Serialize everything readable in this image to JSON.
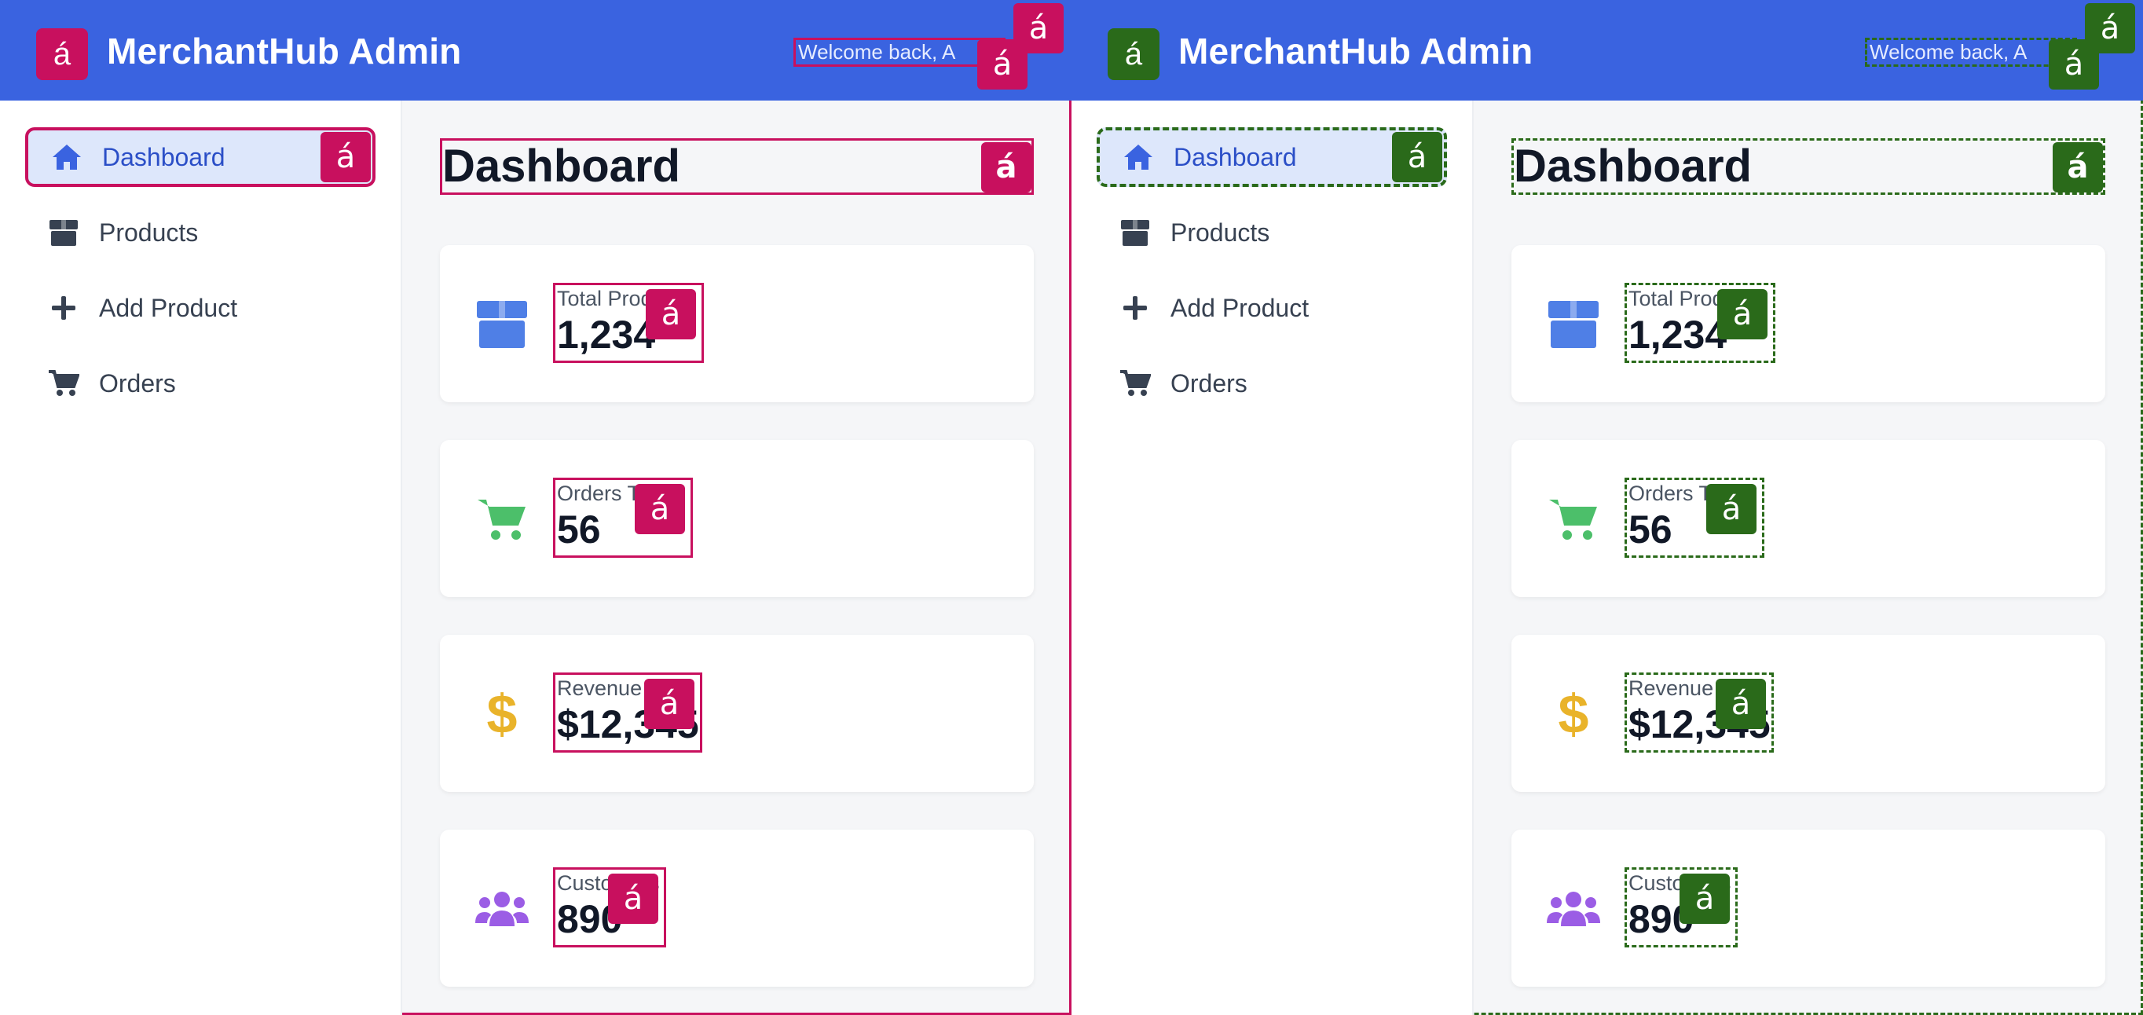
{
  "app": {
    "title": "MerchantHub Admin",
    "welcome_text": "Welcome back, A",
    "badge_glyph": "á",
    "logo_glyph": "á"
  },
  "sidebar": {
    "items": [
      {
        "label": "Dashboard",
        "icon": "home-icon",
        "active": true
      },
      {
        "label": "Products",
        "icon": "box-icon",
        "active": false
      },
      {
        "label": "Add Product",
        "icon": "plus-icon",
        "active": false
      },
      {
        "label": "Orders",
        "icon": "cart-icon",
        "active": false
      }
    ]
  },
  "main": {
    "page_title": "Dashboard",
    "stats": [
      {
        "label": "Total Products",
        "value": "1,234",
        "icon": "box-icon",
        "color": "#4f7fe6"
      },
      {
        "label": "Orders Today",
        "value": "56",
        "icon": "cart-icon",
        "color": "#4cbf6a"
      },
      {
        "label": "Revenue",
        "value": "$12,345",
        "icon": "dollar-icon",
        "color": "#e9b32a"
      },
      {
        "label": "Customers",
        "value": "890",
        "icon": "users-icon",
        "color": "#9b5de5"
      }
    ]
  },
  "colors": {
    "header": "#3a63e0",
    "variant_a_outline": "#c8105e",
    "variant_b_outline": "#2a6a1a"
  }
}
